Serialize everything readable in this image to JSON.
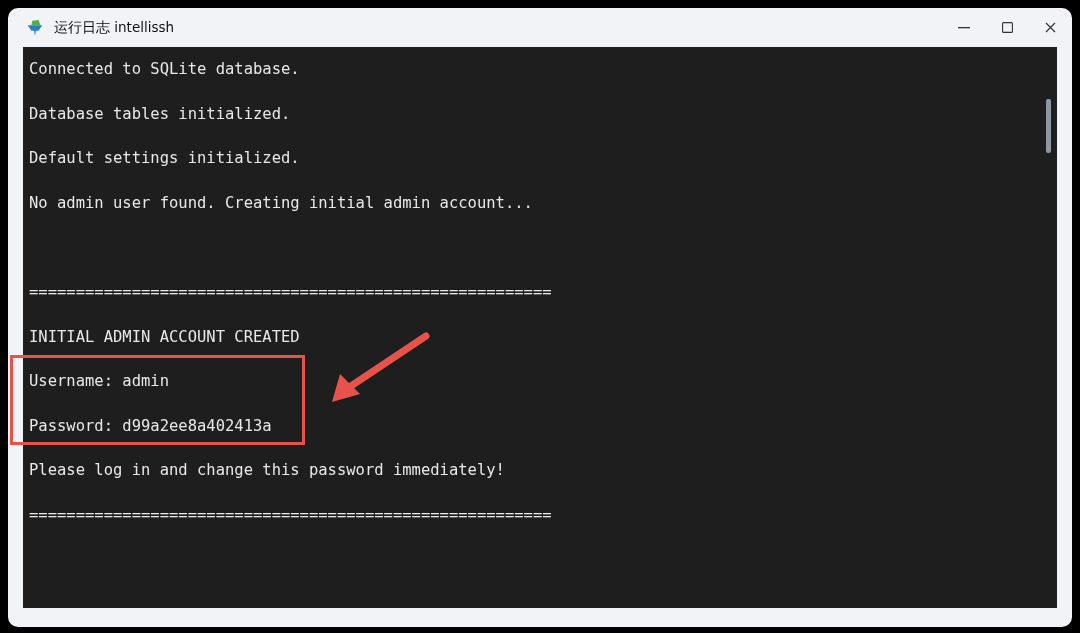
{
  "window": {
    "title": "运行日志 intellissh"
  },
  "log_lines": [
    {
      "kind": "text",
      "text": "Connected to SQLite database."
    },
    {
      "kind": "text",
      "text": "Database tables initialized."
    },
    {
      "kind": "text",
      "text": "Default settings initialized."
    },
    {
      "kind": "text",
      "text": "No admin user found. Creating initial admin account..."
    },
    {
      "kind": "blank"
    },
    {
      "kind": "text",
      "text": "========================================================"
    },
    {
      "kind": "text",
      "text": "INITIAL ADMIN ACCOUNT CREATED"
    },
    {
      "kind": "text",
      "text": "Username: admin"
    },
    {
      "kind": "text",
      "text": "Password: d99a2ee8a402413a"
    },
    {
      "kind": "text",
      "text": "Please log in and change this password immediately!"
    },
    {
      "kind": "text",
      "text": "========================================================"
    }
  ]
}
